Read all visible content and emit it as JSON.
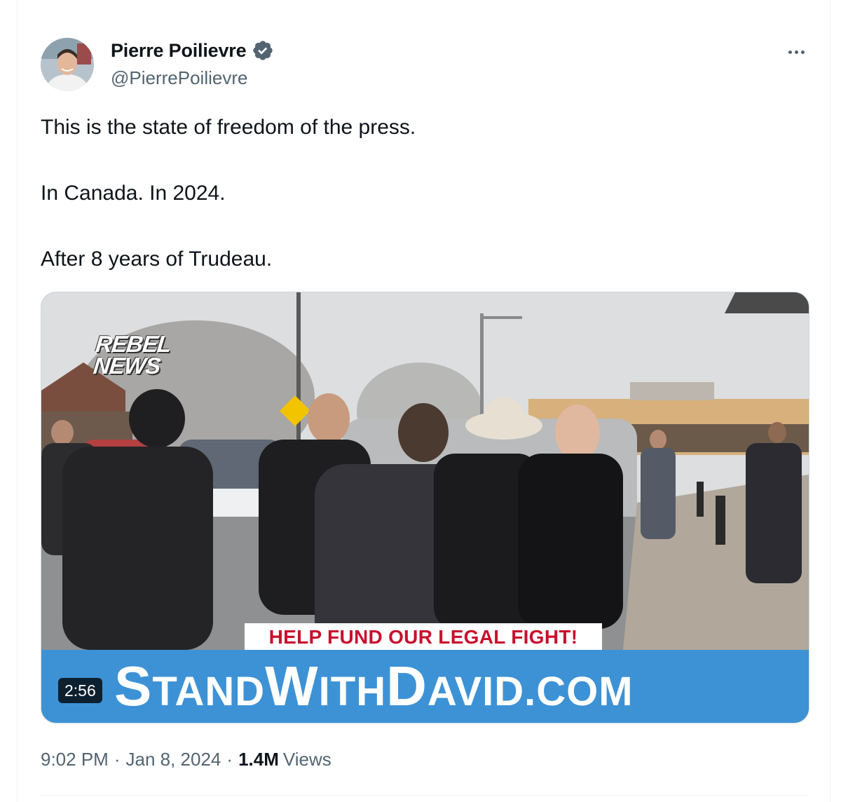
{
  "author": {
    "display_name": "Pierre Poilievre",
    "handle": "@PierrePoilievre",
    "verified": true,
    "verified_color": "#1d9bf0"
  },
  "icons": {
    "verified": "verified-badge-icon",
    "more": "more-options-icon"
  },
  "tweet": {
    "lines": [
      "This is the state of freedom of the press.",
      "In Canada. In 2024.",
      "After 8 years of Trudeau."
    ]
  },
  "media": {
    "logo_line1": "REBEL",
    "logo_line2": "NEWS",
    "banner_top": "HELP FUND OUR LEGAL FIGHT!",
    "banner_site_parts": [
      "S",
      "TAND",
      "W",
      "ITH",
      "D",
      "AVID.COM"
    ],
    "duration": "2:56",
    "banner_red": "#c8102e",
    "banner_blue": "#3d92d6"
  },
  "meta": {
    "time": "9:02 PM",
    "date": "Jan 8, 2024",
    "separator": "·",
    "views_count": "1.4M",
    "views_label": "Views"
  }
}
